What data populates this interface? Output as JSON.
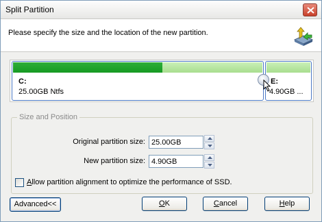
{
  "window": {
    "title": "Split Partition"
  },
  "header": {
    "instruction": "Please specify the size and the location of the new partition."
  },
  "disk_map": {
    "partitions": [
      {
        "letter": "C:",
        "size_label": "25.00GB Ntfs",
        "used_fraction": 0.6
      },
      {
        "letter": "E:",
        "size_label": "4.90GB ...",
        "used_fraction": 0.0
      }
    ]
  },
  "size_position": {
    "group_title": "Size and Position",
    "original_label": "Original partition size:",
    "original_value": "25.00GB",
    "new_label": "New partition size:",
    "new_value": "4.90GB"
  },
  "alignment": {
    "label": "Allow partition alignment to optimize the performance of SSD.",
    "checked": false
  },
  "buttons": {
    "advanced": "Advanced<<",
    "ok": "OK",
    "cancel": "Cancel",
    "help": "Help"
  },
  "icons": {
    "close": "close-icon",
    "header": "partition-split-icon",
    "cursor": "mouse-pointer-icon",
    "spin_up": "up-arrow-icon",
    "spin_down": "down-arrow-icon"
  },
  "colors": {
    "used_space": "#159a22",
    "free_space": "#b9e8a3",
    "partition_border": "#4a78c4",
    "close_button": "#c8402a"
  }
}
